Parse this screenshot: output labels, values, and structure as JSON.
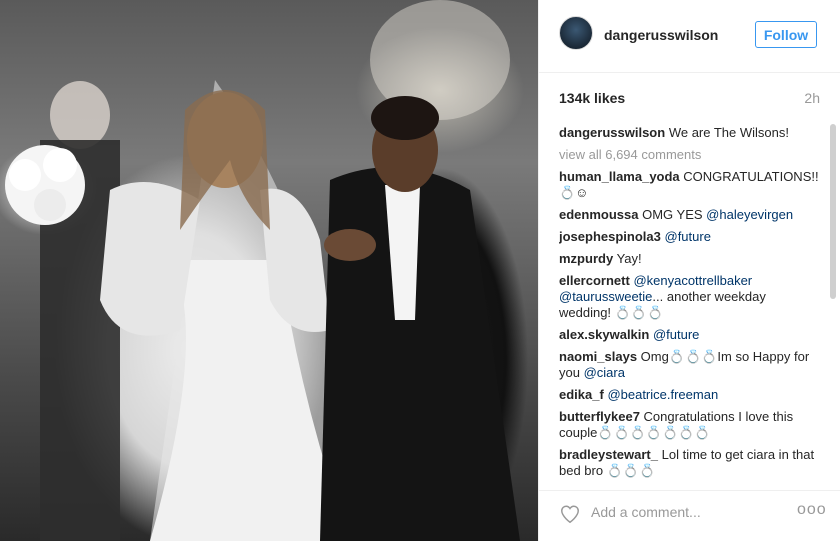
{
  "post": {
    "username": "dangerusswilson",
    "follow_label": "Follow",
    "likes": "134k likes",
    "time": "2h",
    "caption_user": "dangerusswilson",
    "caption_text": "We are The Wilsons!",
    "view_all": "view all 6,694 comments",
    "add_comment_placeholder": "Add a comment...",
    "more_label": "ooo"
  },
  "comments": [
    {
      "user": "human_llama_yoda",
      "text": "CONGRATULATIONS!! 💍☺",
      "mention": ""
    },
    {
      "user": "edenmoussa",
      "text": "OMG YES ",
      "mention": "@haleyevirgen"
    },
    {
      "user": "josephespinola3",
      "text": "",
      "mention": "@future"
    },
    {
      "user": "mzpurdy",
      "text": "Yay!",
      "mention": ""
    },
    {
      "user": "ellercornett",
      "text": "",
      "mention": "@kenyacottrellbaker @taurussweetie",
      "text2": "... another weekday wedding! 💍💍💍"
    },
    {
      "user": "alex.skywalkin",
      "text": "",
      "mention": "@future"
    },
    {
      "user": "naomi_slays",
      "text": "Omg💍💍💍Im so Happy for you ",
      "mention": "@ciara"
    },
    {
      "user": "edika_f",
      "text": "",
      "mention": "@beatrice.freeman"
    },
    {
      "user": "butterflykee7",
      "text": "Congratulations I love this couple💍💍💍💍💍💍💍",
      "mention": ""
    },
    {
      "user": "bradleystewart_",
      "text": "Lol time to get ciara in that bed bro 💍💍💍",
      "mention": ""
    }
  ]
}
